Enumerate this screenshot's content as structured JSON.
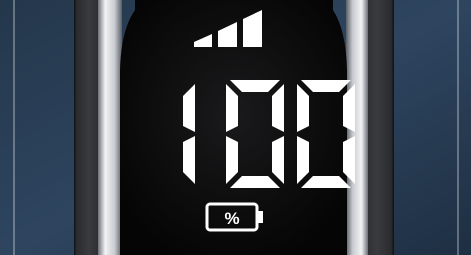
{
  "display": {
    "digits": "100",
    "battery_symbol": "%",
    "signal_level": 3,
    "signal_max": 3
  },
  "colors": {
    "background_left": "#27384c",
    "background_right": "#2a3f57",
    "panel": "#0c0c0d",
    "segment": "#ffffff",
    "chrome": "#c9ccd1"
  },
  "icons": {
    "signal": "signal-strength-icon",
    "battery": "battery-icon"
  }
}
